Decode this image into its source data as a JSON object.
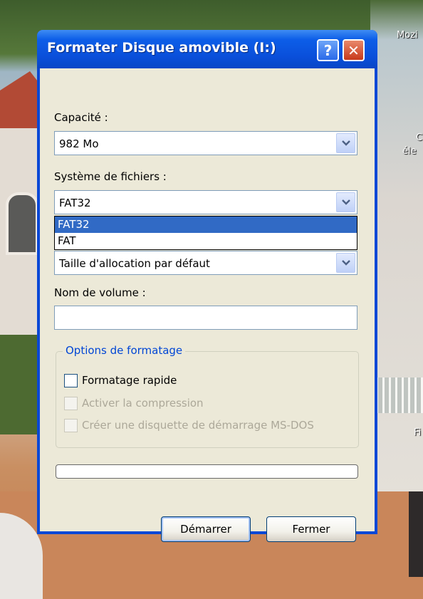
{
  "desktop": {
    "icon_labels": [
      "Mozi",
      "C",
      "éle",
      "Fi"
    ]
  },
  "window": {
    "title": "Formater Disque amovible (I:)",
    "help_label": "?",
    "close_label": "✕"
  },
  "capacity": {
    "label": "Capacité :",
    "value": "982 Mo"
  },
  "file_system": {
    "label": "Système de fichiers :",
    "value": "FAT32",
    "options": [
      "FAT32",
      "FAT"
    ],
    "highlighted": "FAT32"
  },
  "allocation": {
    "value": "Taille d'allocation par défaut"
  },
  "volume": {
    "label": "Nom de volume :",
    "value": ""
  },
  "options": {
    "title": "Options de formatage",
    "quick_format": "Formatage rapide",
    "compression": "Activer la compression",
    "msdos_disk": "Créer une disquette de démarrage MS-DOS"
  },
  "buttons": {
    "start": "Démarrer",
    "close": "Fermer"
  },
  "colors": {
    "title_bar": "#0a4fda",
    "selection": "#316ac5",
    "group_title": "#0046d5"
  }
}
